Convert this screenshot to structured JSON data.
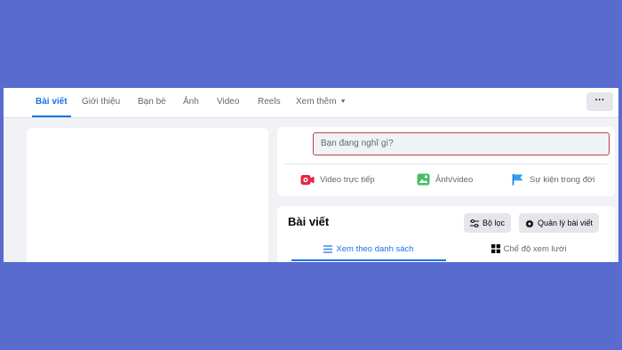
{
  "tabs": [
    {
      "label": "Bài viết",
      "active": true
    },
    {
      "label": "Giới thiệu"
    },
    {
      "label": "Bạn bè"
    },
    {
      "label": "Ảnh"
    },
    {
      "label": "Video"
    },
    {
      "label": "Reels"
    },
    {
      "label": "Xem thêm"
    }
  ],
  "more_button": {
    "label": "···",
    "icon": "ellipsis-icon"
  },
  "composer": {
    "placeholder": "Bạn đang nghĩ gì?",
    "highlight_color": "#b9463e",
    "actions": [
      {
        "label": "Video trực tiếp",
        "icon": "live-video-icon",
        "color": "#e42645"
      },
      {
        "label": "Ảnh/video",
        "icon": "photo-video-icon",
        "color": "#45bd62"
      },
      {
        "label": "Sự kiện trong đời",
        "icon": "life-event-flag-icon",
        "color": "#1b74e4"
      }
    ]
  },
  "posts": {
    "title": "Bài viết",
    "filter_label": "Bộ lọc",
    "manage_label": "Quản lý bài viết",
    "view_tabs": [
      {
        "label": "Xem theo danh sách",
        "icon": "list-view-icon",
        "active": true
      },
      {
        "label": "Chế độ xem lưới",
        "icon": "grid-view-icon"
      }
    ]
  },
  "colors": {
    "background": "#5a6bd0",
    "accent": "#1b74e4",
    "card": "#ffffff",
    "page": "#f0f2f5"
  }
}
